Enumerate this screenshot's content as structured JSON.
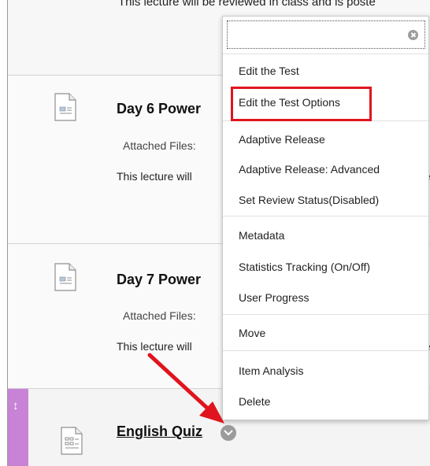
{
  "content_items": {
    "top_item": {
      "text": "This lecture will be reviewed in class and is poste"
    },
    "day6": {
      "title": "Day 6 Power",
      "attached_label": "Attached Files:",
      "desc": "This lecture will",
      "cut1": "l",
      "cut2": "e"
    },
    "day7": {
      "title": "Day 7 Power",
      "attached_label": "Attached Files:",
      "desc": "This lecture will",
      "cut2": "e"
    },
    "quiz": {
      "title": "English Quiz"
    }
  },
  "context_menu": {
    "search_value": "",
    "search_placeholder": "",
    "items": [
      {
        "label": "Edit the Test"
      },
      {
        "label": "Edit the Test Options"
      },
      {
        "label": "Adaptive Release"
      },
      {
        "label": "Adaptive Release: Advanced"
      },
      {
        "label": "Set Review Status(Disabled)"
      },
      {
        "label": "Metadata"
      },
      {
        "label": "Statistics Tracking (On/Off)"
      },
      {
        "label": "User Progress"
      },
      {
        "label": "Move"
      },
      {
        "label": "Item Analysis"
      },
      {
        "label": "Delete"
      }
    ]
  },
  "colors": {
    "highlight_box": "#e0141e",
    "arrow": "#e0141e",
    "quiz_bar": "#c882d6",
    "chevron": "#9b9b9b"
  },
  "icons": {
    "document": "document-icon",
    "quiz": "quiz-document-icon",
    "drag": "drag-handle-icon",
    "chevron": "chevron-down-icon",
    "clear": "clear-search-icon"
  }
}
